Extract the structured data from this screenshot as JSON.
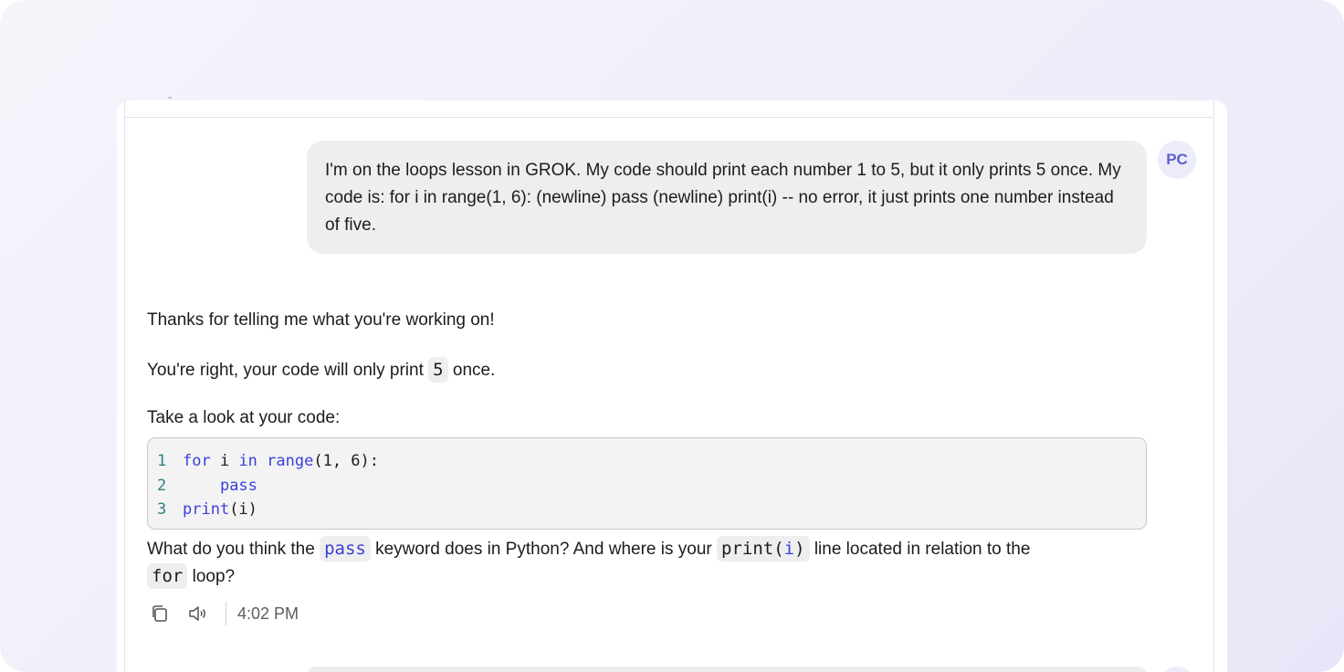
{
  "user_message": {
    "avatar_initials": "PC",
    "text": "I'm on the loops lesson in GROK. My code should print each number 1 to 5, but it only prints 5 once. My code is: for i in range(1, 6): (newline) pass (newline) print(i)  -- no error, it just prints one number instead of five."
  },
  "assistant_message": {
    "line1": "Thanks for telling me what you're working on!",
    "line2_before": "You're right, your code will only print",
    "line2_code": "5",
    "line2_after": "once.",
    "line3": "Take a look at your code:",
    "code_lines": [
      {
        "num": "1",
        "kw1": "for",
        "t1": " i ",
        "kw2": "in",
        "t2": " ",
        "kw3": "range",
        "t3": "(1, 6):"
      },
      {
        "num": "2",
        "indent": "    ",
        "kw1": "pass"
      },
      {
        "num": "3",
        "kw1": "print",
        "t1": "(i)"
      }
    ],
    "question_part1": "What do you think the",
    "question_code1": "pass",
    "question_part2": "keyword does in Python? And where is your",
    "question_code2_fn": "print(",
    "question_code2_arg": "i",
    "question_code2_end": ")",
    "question_part3": "line located in relation to the",
    "question_code3": "for",
    "question_part4": "loop?",
    "timestamp": "4:02 PM"
  },
  "icons": {
    "copy": "copy-icon",
    "speaker": "speaker-icon"
  },
  "colors": {
    "keyword": "#3b3fd8",
    "line_number": "#2f7f86",
    "avatar_text": "#5a5fcf"
  }
}
